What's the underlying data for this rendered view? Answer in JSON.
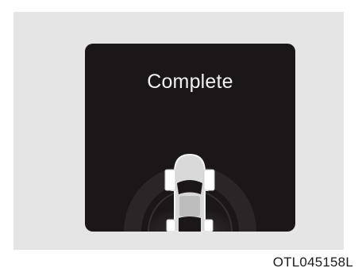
{
  "display": {
    "status_text": "Complete",
    "icon": "vehicle-top-view-icon"
  },
  "image_code": "OTL045158L",
  "colors": {
    "panel_background": "#e5e5e5",
    "screen_background": "#1b1719",
    "text": "#f2f2f2",
    "vehicle": "#e6e6e6"
  }
}
